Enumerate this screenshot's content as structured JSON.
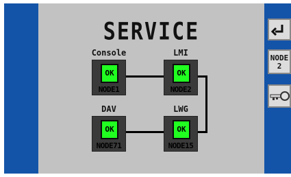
{
  "screen": {
    "title": "SERVICE"
  },
  "nodes": [
    {
      "label": "Console",
      "status": "OK",
      "id": "NODE1"
    },
    {
      "label": "LMI",
      "status": "OK",
      "id": "NODE2"
    },
    {
      "label": "DAV",
      "status": "OK",
      "id": "NODE71"
    },
    {
      "label": "LWG",
      "status": "OK",
      "id": "NODE15"
    }
  ],
  "sidebar": {
    "enter_icon": "return-arrow-icon",
    "node_button": {
      "line1": "NODE",
      "line2": "2"
    },
    "key_icon": "key-icon"
  },
  "colors": {
    "background": "#1454a8",
    "panel": "#c2c2c2",
    "node_frame": "#3a3a3a",
    "status_ok": "#21ff21"
  }
}
